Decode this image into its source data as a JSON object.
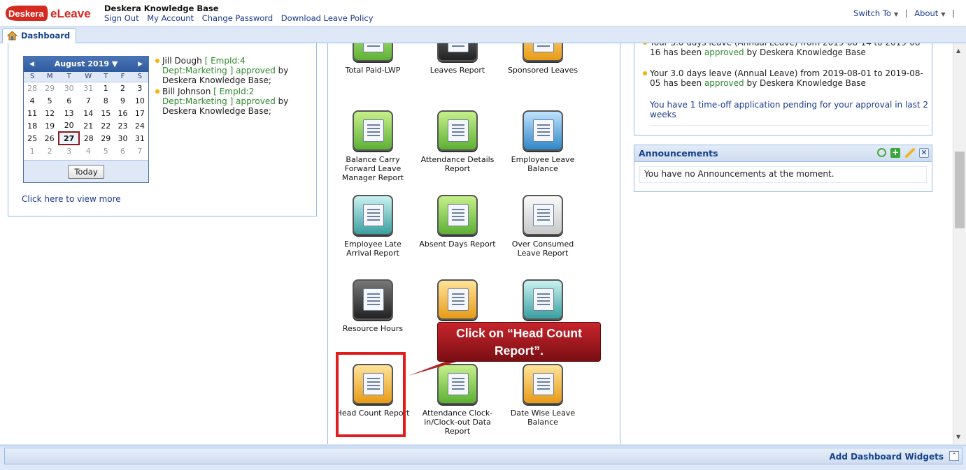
{
  "header": {
    "brand_title": "Deskera Knowledge Base",
    "links": [
      "Sign Out",
      "My Account",
      "Change Password",
      "Download Leave Policy"
    ],
    "switch_to": "Switch To",
    "about": "About",
    "logo_text_1": "Deskera",
    "logo_text_2": "eLeave"
  },
  "tab": {
    "label": "Dashboard"
  },
  "calendar": {
    "month_label": "August 2019 ▼",
    "days": [
      "S",
      "M",
      "T",
      "W",
      "T",
      "F",
      "S"
    ],
    "weeks": [
      [
        "28",
        "29",
        "30",
        "31",
        "1",
        "2",
        "3"
      ],
      [
        "4",
        "5",
        "6",
        "7",
        "8",
        "9",
        "10"
      ],
      [
        "11",
        "12",
        "13",
        "14",
        "15",
        "16",
        "17"
      ],
      [
        "18",
        "19",
        "20",
        "21",
        "22",
        "23",
        "24"
      ],
      [
        "25",
        "26",
        "27",
        "28",
        "29",
        "30",
        "31"
      ],
      [
        "1",
        "2",
        "3",
        "4",
        "5",
        "6",
        "7"
      ]
    ],
    "today_button": "Today"
  },
  "approvals": {
    "item1": {
      "name": "Jill Dough",
      "detail": "[ EmpId:4 Dept:Marketing ]",
      "status": "approved",
      "by": "by Deskera Knowledge Base;"
    },
    "item2": {
      "name": "Bill Johnson",
      "detail": "[ EmpId:2 Dept:Marketing ]",
      "status": "approved",
      "by": "by Deskera Knowledge Base;"
    }
  },
  "view_more": "Click here to view more",
  "reports": [
    {
      "label": "Total Paid-LWP",
      "icon": "calendar-check-icon",
      "color": "green"
    },
    {
      "label": "Leaves Report",
      "icon": "report-icon",
      "color": "black"
    },
    {
      "label": "Sponsored Leaves",
      "icon": "people-icon",
      "color": "orange"
    },
    {
      "label": "Balance Carry Forward Leave Manager Report",
      "icon": "carry-forward-icon",
      "color": "green"
    },
    {
      "label": "Attendance Details Report",
      "icon": "table-icon",
      "color": "green"
    },
    {
      "label": "Employee Leave Balance",
      "icon": "employee-balance-icon",
      "color": "blue"
    },
    {
      "label": "Employee Late Arrival Report",
      "icon": "late-arrival-icon",
      "color": "teal"
    },
    {
      "label": "Absent Days Report",
      "icon": "absent-days-icon",
      "color": "green"
    },
    {
      "label": "Over Consumed Leave Report",
      "icon": "calendar-icon",
      "color": "gray"
    },
    {
      "label": "Resource Hours",
      "icon": "notebook-icon",
      "color": "black"
    },
    {
      "label": "",
      "icon": "user-icon",
      "color": "orange"
    },
    {
      "label": "",
      "icon": "signature-icon",
      "color": "teal"
    },
    {
      "label": "Head Count Report",
      "icon": "head-count-icon",
      "color": "orange"
    },
    {
      "label": "Attendance Clock-in/Clock-out Data Report",
      "icon": "clock-icon",
      "color": "green"
    },
    {
      "label": "Date Wise Leave Balance",
      "icon": "date-wise-icon",
      "color": "orange"
    }
  ],
  "notifications": {
    "partial": "Your 3.0 days leave (Annual Leave) from 2019-08-14 to 2019-08-16",
    "partial_tail": "has been",
    "n1_text": "Your 3.0 days leave (Annual Leave) from 2019-08-01 to 2019-08-05",
    "n1_tail": "has been",
    "status": "approved",
    "by": "by Deskera Knowledge Base",
    "pending": "You have 1 time-off application pending for your approval in last 2 weeks"
  },
  "announcements": {
    "title": "Announcements",
    "empty_text": "You have no Announcements at the moment."
  },
  "footer": {
    "add_widgets": "Add Dashboard Widgets"
  },
  "callout": {
    "text": "Click on “Head Count Report”."
  },
  "colors": {
    "accent": "#15428b",
    "highlight": "#e11c1c",
    "callout": "#a61b21"
  }
}
